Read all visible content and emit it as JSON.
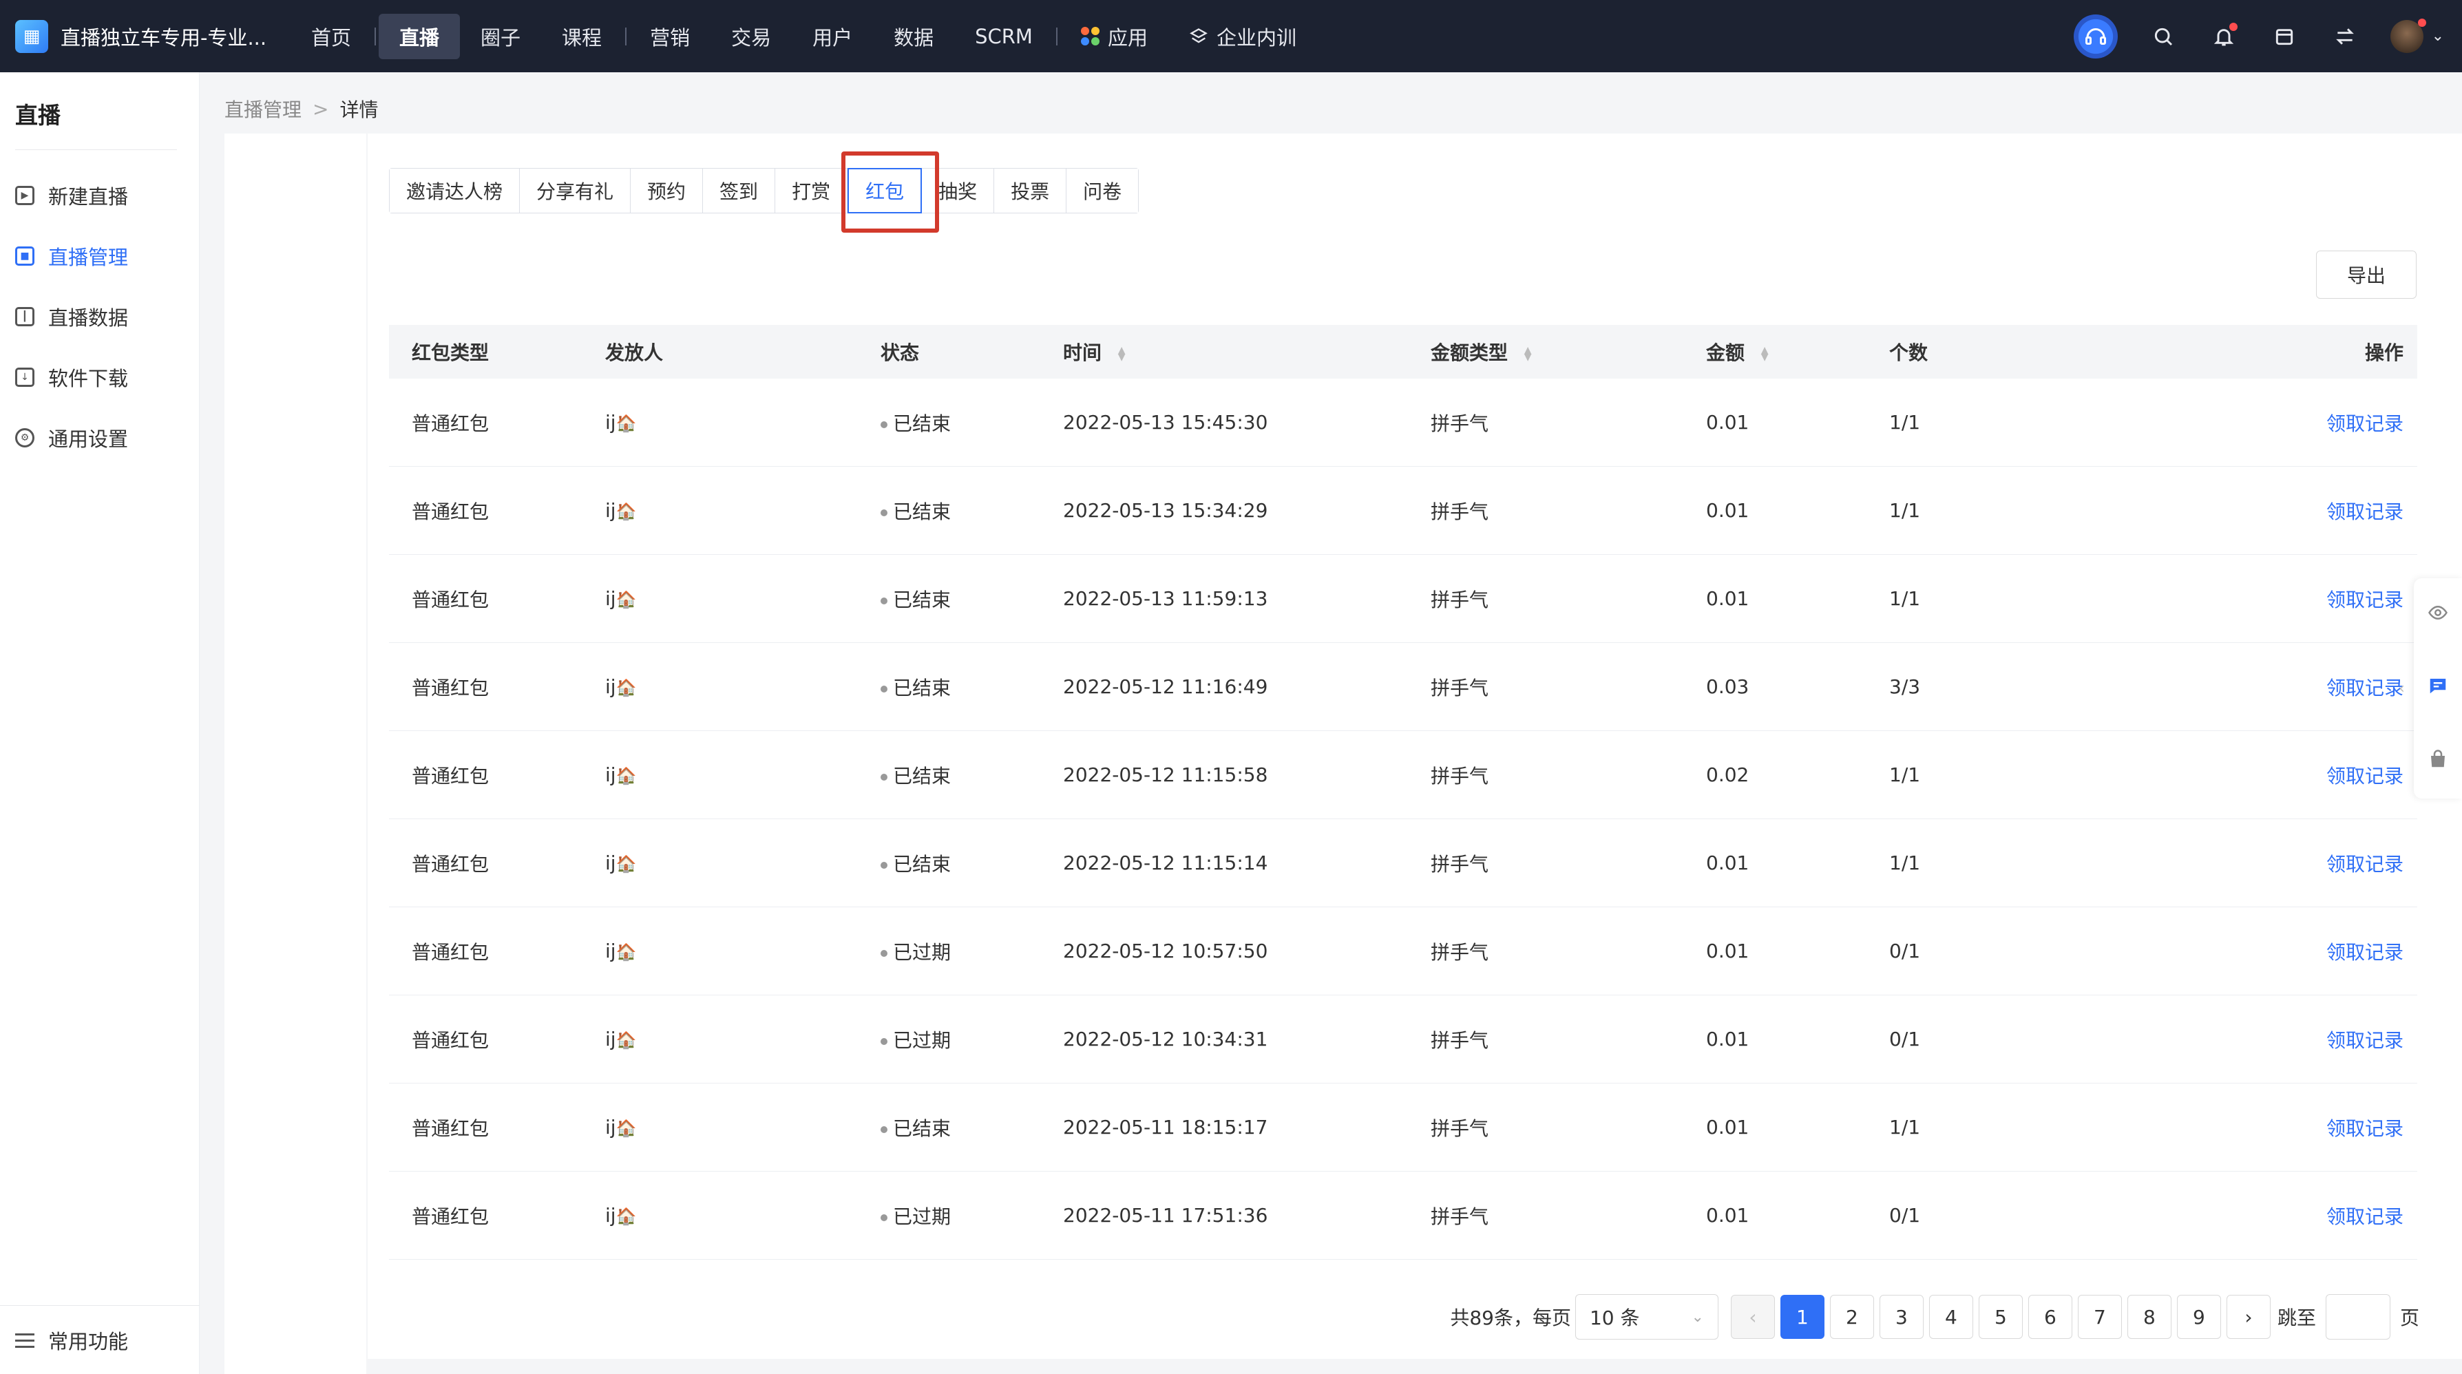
{
  "app": {
    "title": "直播独立车专用-专业...",
    "logo_glyph": "▦"
  },
  "nav": {
    "items": [
      {
        "label": "首页",
        "active": false,
        "sep_before": false
      },
      {
        "label": "直播",
        "active": true,
        "sep_before": true
      },
      {
        "label": "圈子",
        "active": false,
        "sep_before": false
      },
      {
        "label": "课程",
        "active": false,
        "sep_before": false
      },
      {
        "label": "营销",
        "active": false,
        "sep_before": true
      },
      {
        "label": "交易",
        "active": false,
        "sep_before": false
      },
      {
        "label": "用户",
        "active": false,
        "sep_before": false
      },
      {
        "label": "数据",
        "active": false,
        "sep_before": false
      },
      {
        "label": "SCRM",
        "active": false,
        "sep_before": false
      }
    ],
    "apps_label": "应用",
    "training_label": "企业内训",
    "apps_dot_colors": [
      "#ff6b3d",
      "#ffc233",
      "#3d8bff",
      "#6ad26a"
    ]
  },
  "topright": {
    "icons": [
      "support-icon",
      "search-icon",
      "bell-icon",
      "store-icon",
      "switch-icon"
    ]
  },
  "sidebar": {
    "title": "直播",
    "items": [
      {
        "label": "新建直播",
        "icon": "video-add-icon",
        "active": false
      },
      {
        "label": "直播管理",
        "icon": "live-manage-icon",
        "active": true
      },
      {
        "label": "直播数据",
        "icon": "data-icon",
        "active": false
      },
      {
        "label": "软件下载",
        "icon": "download-icon",
        "active": false
      },
      {
        "label": "通用设置",
        "icon": "gear-icon",
        "active": false
      }
    ],
    "bottom_label": "常用功能"
  },
  "breadcrumb": {
    "parent": "直播管理",
    "separator": ">",
    "current": "详情"
  },
  "tabs": [
    {
      "label": "邀请达人榜",
      "active": false
    },
    {
      "label": "分享有礼",
      "active": false
    },
    {
      "label": "预约",
      "active": false
    },
    {
      "label": "签到",
      "active": false
    },
    {
      "label": "打赏",
      "active": false
    },
    {
      "label": "红包",
      "active": true
    },
    {
      "label": "抽奖",
      "active": false
    },
    {
      "label": "投票",
      "active": false
    },
    {
      "label": "问卷",
      "active": false
    }
  ],
  "toolbar": {
    "export_label": "导出"
  },
  "table": {
    "headers": {
      "type": "红包类型",
      "sender": "发放人",
      "status": "状态",
      "time": "时间",
      "amount_type": "金额类型",
      "amount": "金额",
      "count": "个数",
      "action": "操作"
    },
    "rows": [
      {
        "type": "普通红包",
        "sender": "ij",
        "status": "已结束",
        "time": "2022-05-13 15:45:30",
        "amount_type": "拼手气",
        "amount": "0.01",
        "count": "1/1",
        "action": "领取记录"
      },
      {
        "type": "普通红包",
        "sender": "ij",
        "status": "已结束",
        "time": "2022-05-13 15:34:29",
        "amount_type": "拼手气",
        "amount": "0.01",
        "count": "1/1",
        "action": "领取记录"
      },
      {
        "type": "普通红包",
        "sender": "ij",
        "status": "已结束",
        "time": "2022-05-13 11:59:13",
        "amount_type": "拼手气",
        "amount": "0.01",
        "count": "1/1",
        "action": "领取记录"
      },
      {
        "type": "普通红包",
        "sender": "ij",
        "status": "已结束",
        "time": "2022-05-12 11:16:49",
        "amount_type": "拼手气",
        "amount": "0.03",
        "count": "3/3",
        "action": "领取记录"
      },
      {
        "type": "普通红包",
        "sender": "ij",
        "status": "已结束",
        "time": "2022-05-12 11:15:58",
        "amount_type": "拼手气",
        "amount": "0.02",
        "count": "1/1",
        "action": "领取记录"
      },
      {
        "type": "普通红包",
        "sender": "ij",
        "status": "已结束",
        "time": "2022-05-12 11:15:14",
        "amount_type": "拼手气",
        "amount": "0.01",
        "count": "1/1",
        "action": "领取记录"
      },
      {
        "type": "普通红包",
        "sender": "ij",
        "status": "已过期",
        "time": "2022-05-12 10:57:50",
        "amount_type": "拼手气",
        "amount": "0.01",
        "count": "0/1",
        "action": "领取记录"
      },
      {
        "type": "普通红包",
        "sender": "ij",
        "status": "已过期",
        "time": "2022-05-12 10:34:31",
        "amount_type": "拼手气",
        "amount": "0.01",
        "count": "0/1",
        "action": "领取记录"
      },
      {
        "type": "普通红包",
        "sender": "ij",
        "status": "已结束",
        "time": "2022-05-11 18:15:17",
        "amount_type": "拼手气",
        "amount": "0.01",
        "count": "1/1",
        "action": "领取记录"
      },
      {
        "type": "普通红包",
        "sender": "ij",
        "status": "已过期",
        "time": "2022-05-11 17:51:36",
        "amount_type": "拼手气",
        "amount": "0.01",
        "count": "0/1",
        "action": "领取记录"
      }
    ]
  },
  "pagination": {
    "total_text": "共89条，每页",
    "page_size": "10 条",
    "pages": [
      "1",
      "2",
      "3",
      "4",
      "5",
      "6",
      "7",
      "8",
      "9"
    ],
    "current": "1",
    "jump_label": "跳至",
    "page_suffix": "页"
  },
  "colors": {
    "accent": "#2f6ff6",
    "topbar": "#1c2231",
    "highlight": "#d23a2c"
  }
}
